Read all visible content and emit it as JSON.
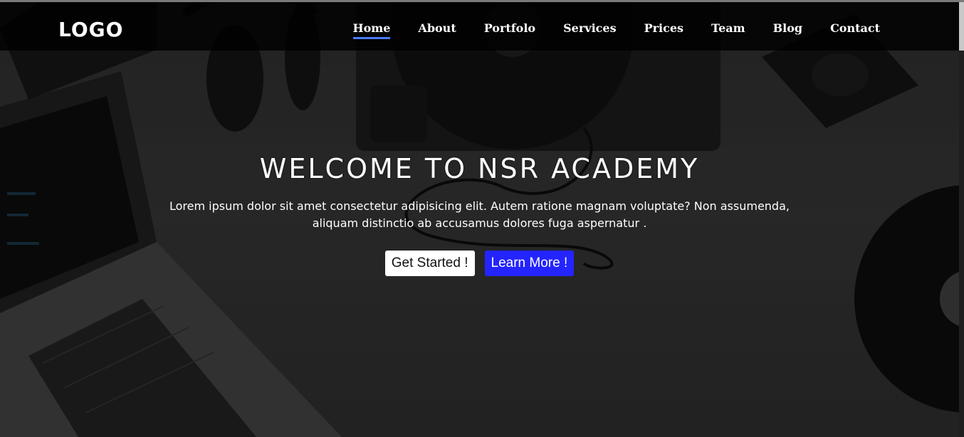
{
  "nav": {
    "logo": "LOGO",
    "items": [
      {
        "label": "Home",
        "active": true
      },
      {
        "label": "About",
        "active": false
      },
      {
        "label": "Portfolo",
        "active": false
      },
      {
        "label": "Services",
        "active": false
      },
      {
        "label": "Prices",
        "active": false
      },
      {
        "label": "Team",
        "active": false
      },
      {
        "label": "Blog",
        "active": false
      },
      {
        "label": "Contact",
        "active": false
      }
    ],
    "active_underline_color": "#4a7bff"
  },
  "hero": {
    "title": "WELCOME TO NSR ACADEMY",
    "text": "Lorem ipsum dolor sit amet consectetur adipisicing elit. Autem ratione magnam voluptate? Non assumenda, aliquam distinctio ab accusamus dolores fuga aspernatur .",
    "buttons": {
      "start_label": "Get Started !",
      "learn_label": "Learn More !"
    },
    "learn_button_color": "#2424ff"
  }
}
